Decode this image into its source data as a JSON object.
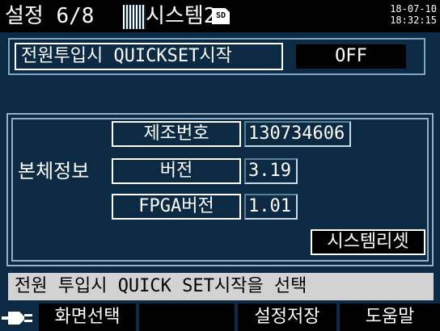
{
  "header": {
    "title": "설정 6/8",
    "tab_label": "시스템2",
    "sd_icon_text": "SD",
    "date": "18-07-10",
    "time": "18:32:15"
  },
  "quickset": {
    "label": "전원투입시 QUICKSET시작",
    "value": "OFF"
  },
  "device_info": {
    "title": "본체정보",
    "serial_label": "제조번호",
    "serial_value": "130734606",
    "version_label": "버전",
    "version_value": "3.19",
    "fpga_label": "FPGA버전",
    "fpga_value": "1.01",
    "reset_button": "시스템리셋"
  },
  "help_text": "전원 투입시 QUICK SET시작을 선택",
  "function_keys": {
    "screen_select": "화면선택",
    "empty": "",
    "save_settings": "설정저장",
    "help": "도움말"
  },
  "icons": {
    "sd": "sd-card-icon",
    "plug": "power-plug-icon",
    "tab": "tab-stripes-icon"
  },
  "colors": {
    "background": "#0d2a44",
    "titlebar": "#000000",
    "help_bar": "#d2d2d2",
    "panel_border": "#8fb0c8"
  }
}
